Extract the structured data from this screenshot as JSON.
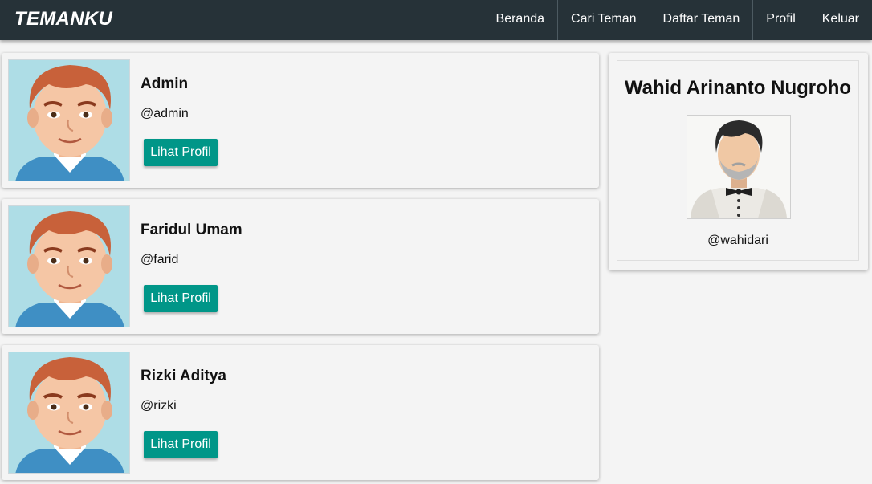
{
  "navbar": {
    "brand": "TEMANKU",
    "links": [
      "Beranda",
      "Cari Teman",
      "Daftar Teman",
      "Profil",
      "Keluar"
    ]
  },
  "friends": [
    {
      "name": "Admin",
      "username": "@admin",
      "button_label": "Lihat Profil"
    },
    {
      "name": "Faridul Umam",
      "username": "@farid",
      "button_label": "Lihat Profil"
    },
    {
      "name": "Rizki Aditya",
      "username": "@rizki",
      "button_label": "Lihat Profil"
    }
  ],
  "profile": {
    "name": "Wahid Arinanto Nugroho",
    "username": "@wahidari"
  },
  "colors": {
    "navbar_bg": "#263238",
    "button_bg": "#009688",
    "page_bg": "#f4f4f4",
    "avatar_bg": "#aedde6"
  },
  "icons": {
    "friend_avatar": "cartoon-man-avatar",
    "profile_photo": "bowtie-man-avatar"
  }
}
